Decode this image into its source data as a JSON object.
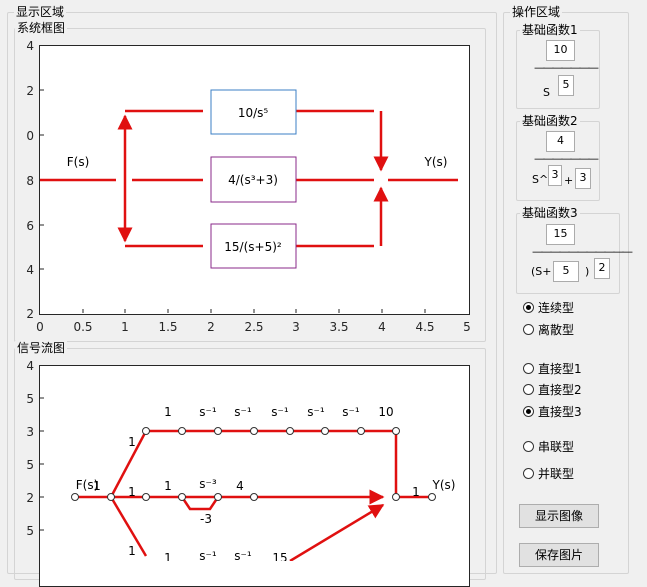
{
  "display_panel": {
    "title": "显示区域"
  },
  "block_diagram": {
    "title": "系统框图",
    "y_ticks": [
      "4",
      "2",
      "0",
      "8",
      "6",
      "4",
      "2"
    ],
    "x_ticks": [
      "0",
      "0.5",
      "1",
      "1.5",
      "2",
      "2.5",
      "3",
      "3.5",
      "4",
      "4.5",
      "5"
    ],
    "input_label": "F(s)",
    "output_label": "Y(s)",
    "block1": "10/s⁵",
    "block2": "4/(s³+3)",
    "block3": "15/(s+5)²"
  },
  "signal_flow": {
    "title": "信号流图",
    "y_ticks": [
      "4",
      "5",
      "3",
      "5",
      "2",
      "5"
    ],
    "input_label": "F(s)",
    "output_label": "Y(s)",
    "top_gains": [
      "1",
      "s⁻¹",
      "s⁻¹",
      "s⁻¹",
      "s⁻¹",
      "s⁻¹",
      "10"
    ],
    "mid_gains": [
      "1",
      "s⁻³",
      "4"
    ],
    "mid_feedback": "-3",
    "bottom_gains": [
      "1",
      "s⁻¹",
      "s⁻¹",
      "15"
    ],
    "in_gain": "1",
    "branch_top": "1",
    "branch_mid": "1",
    "branch_bottom": "1",
    "out_gain": "1"
  },
  "ops_panel": {
    "title": "操作区域"
  },
  "func1": {
    "title": "基础函数1",
    "numerator": "10",
    "dashes": "———————",
    "s_label": "S",
    "power": "5"
  },
  "func2": {
    "title": "基础函数2",
    "numerator": "4",
    "dashes": "———————",
    "s_label": "S^",
    "power": "3",
    "plus": "+",
    "constant": "3"
  },
  "func3": {
    "title": "基础函数3",
    "numerator": "15",
    "dashes": "———————————",
    "open": "(S+",
    "constant": "5",
    "close": ")",
    "power": "2"
  },
  "mode": {
    "continuous": "连续型",
    "discrete": "离散型",
    "selected": "continuous"
  },
  "form": {
    "direct1": "直接型1",
    "direct2": "直接型2",
    "direct3": "直接型3",
    "series": "串联型",
    "parallel": "并联型",
    "selected": "direct3"
  },
  "buttons": {
    "show": "显示图像",
    "save": "保存图片"
  }
}
